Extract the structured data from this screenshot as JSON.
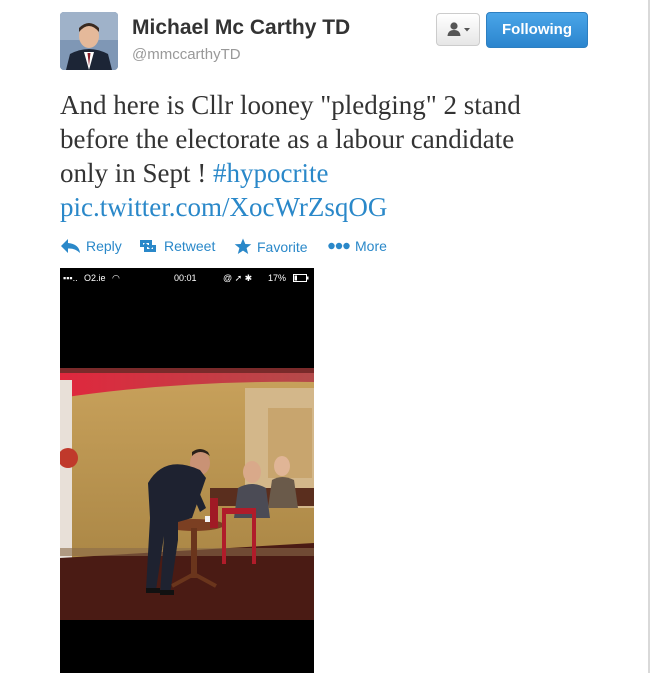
{
  "author": {
    "name": "Michael Mc Carthy TD",
    "handle": "@mmccarthyTD"
  },
  "buttons": {
    "user_menu_icon": "user-dropdown-icon",
    "following_label": "Following"
  },
  "tweet": {
    "text": "And here is Cllr looney \"pledging\" 2 stand\nbefore the electorate as a labour candidate\nonly in Sept  ! ",
    "hashtag": "#hypocrite",
    "pic_link": "pic.twitter.com/XocWrZsqOG"
  },
  "actions": [
    {
      "icon": "reply-icon",
      "label": "Reply"
    },
    {
      "icon": "retweet-icon",
      "label": "Retweet"
    },
    {
      "icon": "star-icon",
      "label": "Favorite"
    },
    {
      "icon": "more-dots-icon",
      "label": "More"
    }
  ],
  "photo_statusbar": {
    "carrier": "O2.ie",
    "time": "00:01",
    "battery": "17%"
  },
  "colors": {
    "link": "#2a88c9",
    "follow_button": "#2b85ce"
  }
}
